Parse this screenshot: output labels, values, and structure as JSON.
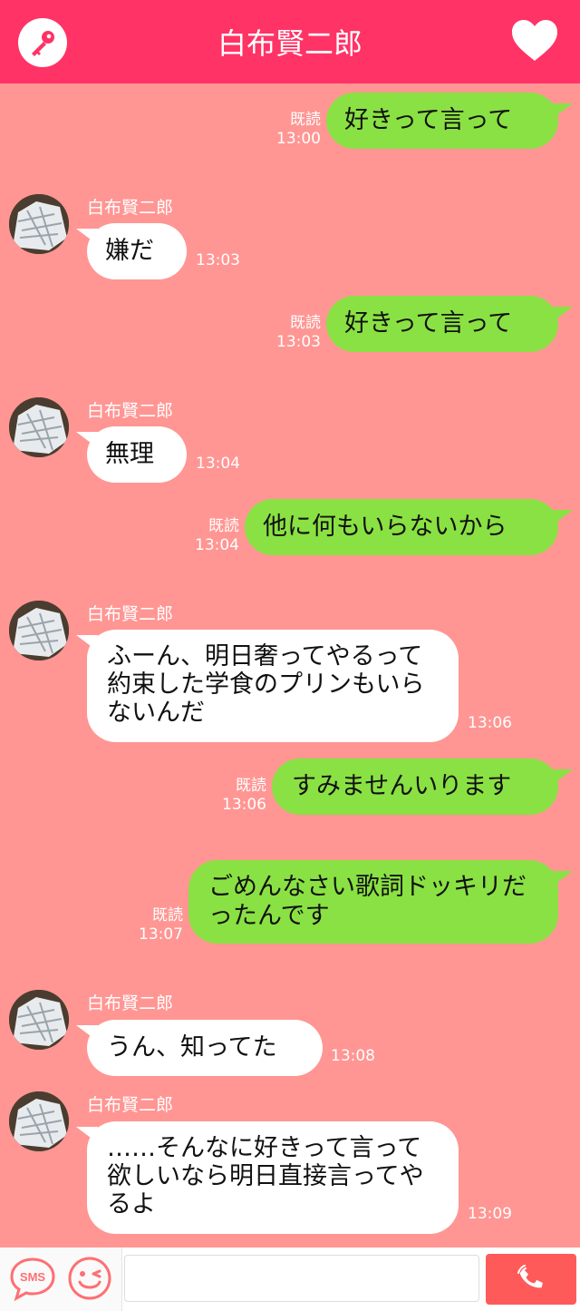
{
  "header": {
    "title": "白布賢二郎"
  },
  "messages": [
    {
      "dir": "out",
      "text": "好きって言って",
      "read": "既読",
      "time": "13:00"
    },
    {
      "dir": "in",
      "sender": "白布賢二郎",
      "text": "嫌だ",
      "time": "13:03"
    },
    {
      "dir": "out",
      "text": "好きって言って",
      "read": "既読",
      "time": "13:03"
    },
    {
      "dir": "in",
      "sender": "白布賢二郎",
      "text": "無理",
      "time": "13:04"
    },
    {
      "dir": "out",
      "text": "他に何もいらないから",
      "read": "既読",
      "time": "13:04"
    },
    {
      "dir": "in",
      "sender": "白布賢二郎",
      "text": "ふーん、明日奢ってやるって約束した学食のプリンもいらないんだ",
      "time": "13:06"
    },
    {
      "dir": "out",
      "text": "すみませんいります",
      "read": "既読",
      "time": "13:06"
    },
    {
      "dir": "out",
      "text": "ごめんなさい歌詞ドッキリだったんです",
      "read": "既読",
      "time": "13:07"
    },
    {
      "dir": "in",
      "sender": "白布賢二郎",
      "text": "うん、知ってた",
      "time": "13:08"
    },
    {
      "dir": "in",
      "sender": "白布賢二郎",
      "text": "……そんなに好きって言って欲しいなら明日直接言ってやるよ",
      "time": "13:09"
    }
  ],
  "footer": {
    "sms_label": "SMS",
    "input_placeholder": ""
  },
  "icons": {
    "key": "key-icon",
    "heart": "heart-icon",
    "sms": "sms-icon",
    "smile": "smile-icon",
    "call": "phone-icon"
  },
  "colors": {
    "header": "#ff3366",
    "background": "#ff9693",
    "outgoing_bubble": "#8ae143",
    "incoming_bubble": "#ffffff",
    "call_button": "#ff5a5a"
  }
}
